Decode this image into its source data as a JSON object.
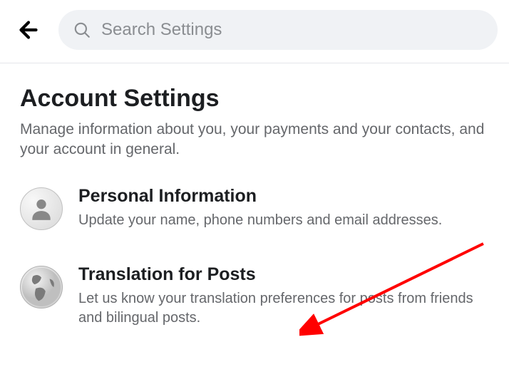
{
  "header": {
    "search_placeholder": "Search Settings"
  },
  "page": {
    "title": "Account Settings",
    "subtitle": "Manage information about you, your payments and your contacts, and your account in general."
  },
  "settings": [
    {
      "title": "Personal Information",
      "description": "Update your name, phone numbers and email addresses."
    },
    {
      "title": "Translation for Posts",
      "description": "Let us know your translation preferences for posts from friends and bilingual posts."
    }
  ]
}
